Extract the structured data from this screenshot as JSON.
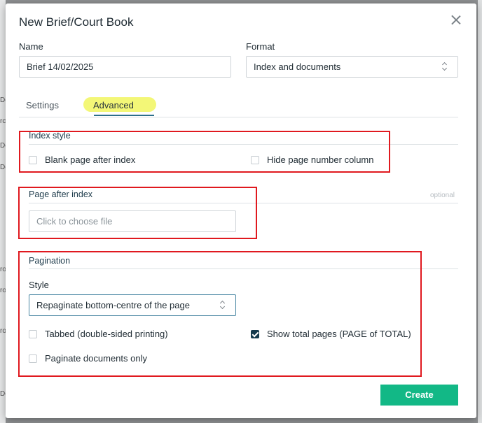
{
  "background": {
    "fragments": [
      "Do",
      "rc",
      "Do",
      "Do",
      "ro",
      "ro",
      "ro",
      "Do"
    ]
  },
  "dialog": {
    "title": "New Brief/Court Book"
  },
  "name_field": {
    "label": "Name",
    "value": "Brief 14/02/2025"
  },
  "format_field": {
    "label": "Format",
    "value": "Index and documents"
  },
  "tabs": [
    {
      "label": "Settings",
      "active": false
    },
    {
      "label": "Advanced",
      "active": true,
      "highlighted": true
    }
  ],
  "index_style": {
    "title": "Index style",
    "options": [
      {
        "label": "Blank page after index",
        "checked": false
      },
      {
        "label": "Hide page number column",
        "checked": false
      }
    ]
  },
  "page_after_index": {
    "title": "Page after index",
    "optional_label": "optional",
    "placeholder": "Click to choose file"
  },
  "pagination": {
    "title": "Pagination",
    "style_label": "Style",
    "style_value": "Repaginate bottom-centre of the page",
    "options": [
      {
        "label": "Tabbed (double-sided printing)",
        "checked": false
      },
      {
        "label": "Show total pages (PAGE of TOTAL)",
        "checked": true
      },
      {
        "label": "Paginate documents only",
        "checked": false
      }
    ]
  },
  "actions": {
    "create_label": "Create"
  },
  "colors": {
    "primary_button": "#12b886",
    "annotation_red": "#e0191f",
    "tab_highlight": "#f3f777",
    "checkbox_checked": "#14394c"
  }
}
